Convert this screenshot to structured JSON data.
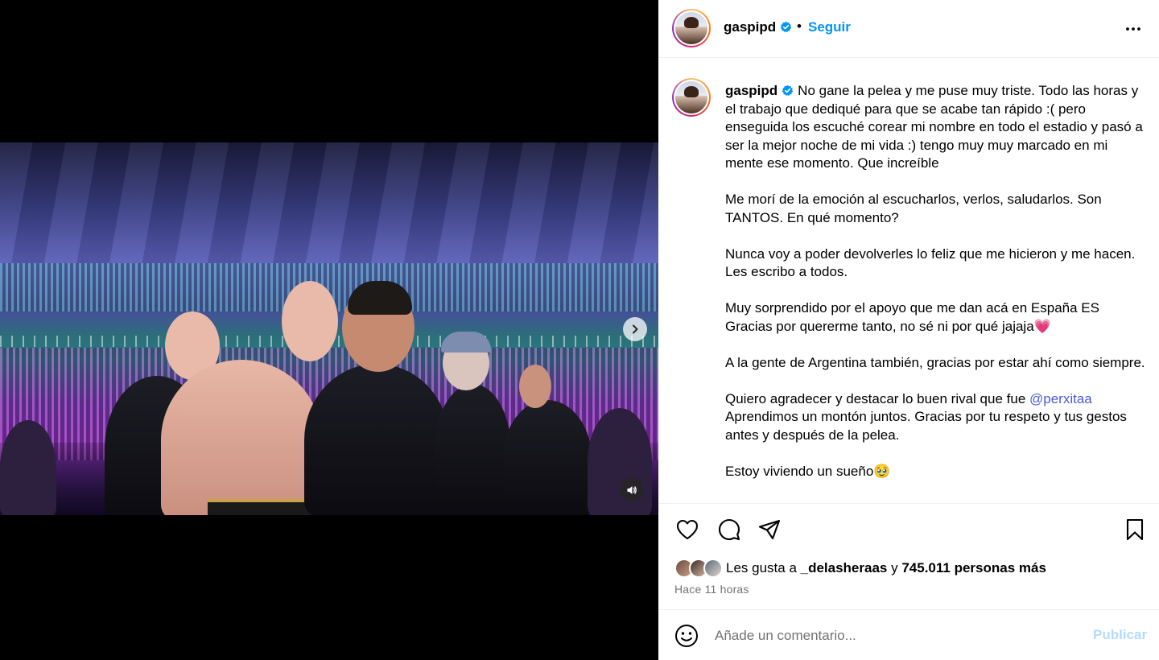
{
  "post": {
    "username": "gaspipd",
    "verified": true,
    "separator": "•",
    "follow_label": "Seguir",
    "more_icon": "more-horizontal-icon"
  },
  "media": {
    "carousel_count": 7,
    "active_index": 0,
    "next_icon": "chevron-right-icon",
    "sound_icon": "speaker-icon"
  },
  "caption": {
    "username": "gaspipd",
    "p1": "No gane la pelea y me puse muy triste. Todo las horas y el trabajo que dediqué para que se acabe tan rápido :( pero enseguida los escuché corear mi nombre en todo el estadio y pasó a ser la mejor noche de mi vida :) tengo muy muy marcado en mi mente ese momento. Que increíble",
    "p2": "Me morí de la emoción al escucharlos, verlos, saludarlos. Son TANTOS. En qué momento?",
    "p3": "Nunca voy a poder devolverles lo feliz que me hicieron y me hacen. Les escribo a todos.",
    "p4": "Muy sorprendido por el apoyo que me dan acá en España ES Gracias por quererme tanto, no sé ni por qué jajaja💗",
    "p5": "A la gente de Argentina también, gracias por estar ahí como siempre.",
    "p6_text": "Quiero agradecer y destacar lo buen rival que fue ",
    "p6_mention": "@perxitaa",
    "p6_rest": " Aprendimos un montón juntos. Gracias por tu respeto y tus gestos antes y después de la pelea.",
    "p7": "Estoy viviendo un sueño🥹"
  },
  "actions": {
    "like_icon": "heart-icon",
    "comment_icon": "comment-icon",
    "share_icon": "send-icon",
    "save_icon": "bookmark-icon"
  },
  "likes": {
    "prefix": "Les gusta a ",
    "user": "_delasheraas",
    "middle": " y ",
    "count": "745.011 personas más"
  },
  "time_ago": "Hace 11 horas",
  "comment": {
    "placeholder": "Añade un comentario...",
    "post_label": "Publicar",
    "emoji_icon": "smiley-icon"
  },
  "colors": {
    "link_blue": "#0095f6",
    "mention": "#4a5bd6",
    "muted": "#737373",
    "disabled_blue": "#b3dbff"
  }
}
